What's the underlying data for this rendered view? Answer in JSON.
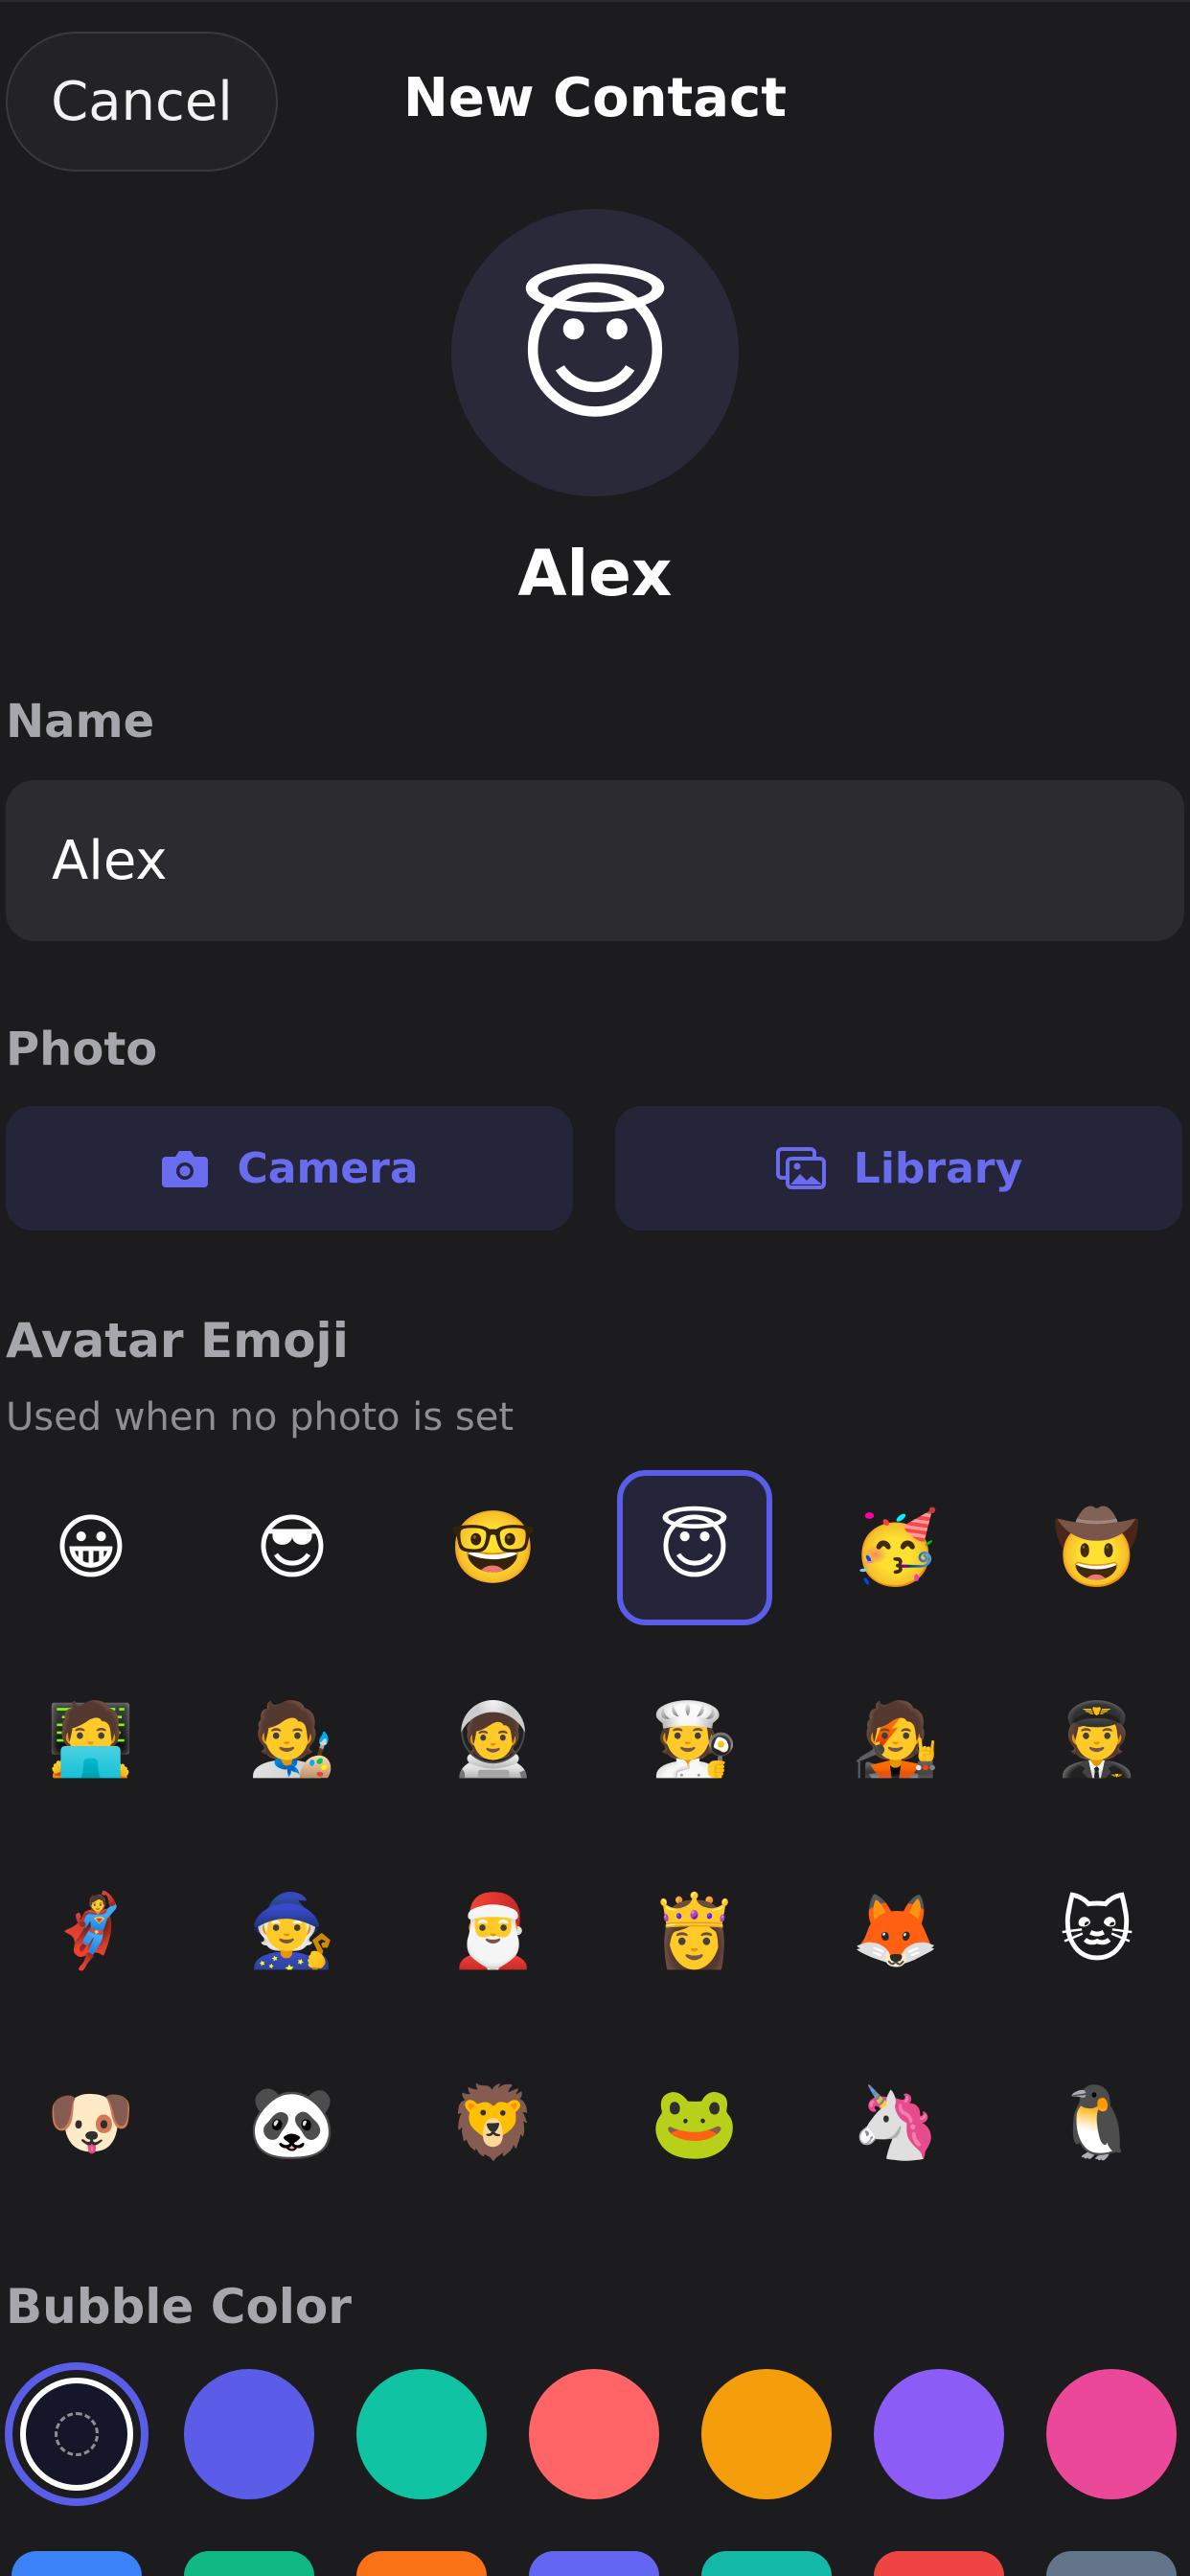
{
  "header": {
    "cancel_label": "Cancel",
    "title": "New Contact"
  },
  "avatar": {
    "emoji": "😇",
    "name": "Alex"
  },
  "name_section": {
    "label": "Name",
    "value": "Alex"
  },
  "photo_section": {
    "label": "Photo",
    "camera_label": "Camera",
    "library_label": "Library",
    "accent_color": "#6a6cf0"
  },
  "emoji_section": {
    "label": "Avatar Emoji",
    "subtext": "Used when no photo is set",
    "selected_index": 3,
    "emojis": [
      "😀",
      "😎",
      "🤓",
      "😇",
      "🥳",
      "🤠",
      "🧑‍💻",
      "🧑‍🎨",
      "🧑‍🚀",
      "🧑‍🍳",
      "🧑‍🎤",
      "🧑‍✈️",
      "🦸",
      "🧙",
      "🎅",
      "👸",
      "🦊",
      "🐱",
      "🐶",
      "🐼",
      "🦁",
      "🐸",
      "🦄",
      "🐧"
    ]
  },
  "bubble_color": {
    "label": "Bubble Color",
    "selected_index": 0,
    "colors": [
      "#16162a",
      "#5b5de8",
      "#10c3a3",
      "#ff6466",
      "#f59e0b",
      "#8b5cf6",
      "#ec4899"
    ],
    "second_row_colors": [
      "#3b82f6",
      "#10b981",
      "#f97316",
      "#6366f1",
      "#14b8a6",
      "#ef4444",
      "#64748b"
    ]
  }
}
